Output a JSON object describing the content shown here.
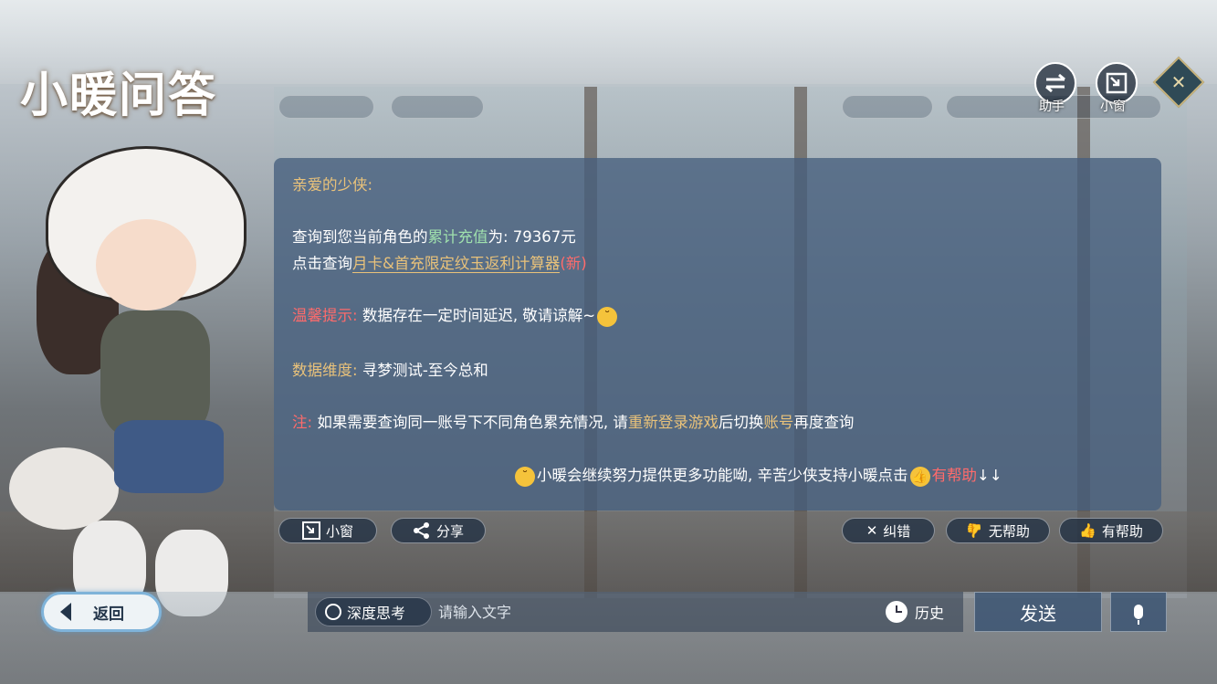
{
  "title": "小暖问答",
  "top_right": {
    "assistant_label": "助手",
    "mini_window_label": "小窗"
  },
  "message": {
    "greeting": "亲爱的少侠:",
    "query_prefix": "查询到您当前角色的",
    "query_highlight": "累计充值",
    "query_suffix": "为: 79367元",
    "click_prefix": "点击查询",
    "calc_link": "月卡&首充限定纹玉返利计算器",
    "new_tag": "(新)",
    "tip_label": "温馨提示:",
    "tip_text": "数据存在一定时间延迟, 敬请谅解~",
    "dim_label": "数据维度:",
    "dim_text": "寻梦测试-至今总和",
    "note_label": "注:",
    "note_part1": "如果需要查询同一账号下不同角色累充情况, 请",
    "note_relogin": "重新登录游戏",
    "note_part2": "后切换",
    "note_account": "账号",
    "note_part3": "再度查询",
    "closing_text": "小暖会继续努力提供更多功能呦, 辛苦少侠支持小暖点击",
    "closing_helpful": "有帮助",
    "closing_arrows": "↓↓"
  },
  "actions": {
    "mini_window": "小窗",
    "share": "分享",
    "correct": "纠错",
    "not_helpful": "无帮助",
    "helpful": "有帮助"
  },
  "bottom": {
    "back": "返回",
    "deep_think": "深度思考",
    "input_placeholder": "请输入文字",
    "history": "历史",
    "send": "发送"
  },
  "icons": [
    "swap-icon",
    "mini-window-icon",
    "close-diamond-icon",
    "share-icon",
    "x-icon",
    "thumbs-down-icon",
    "thumbs-up-icon",
    "clock-icon",
    "mic-icon",
    "back-arrow-icon",
    "emoji-icon"
  ],
  "colors": {
    "panel_bg": "#465f7d",
    "gold": "#e9c27a",
    "green": "#9fe0ad",
    "red": "#ff6b6b"
  }
}
